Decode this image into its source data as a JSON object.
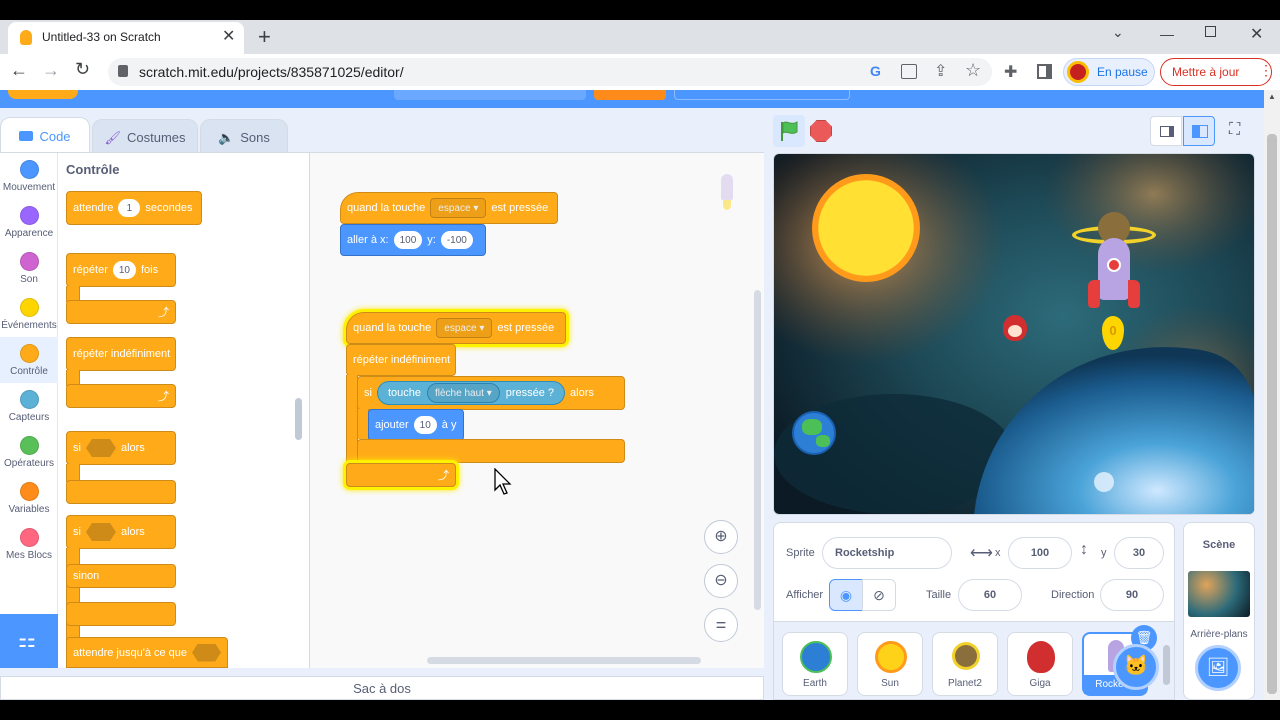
{
  "browser": {
    "tab_title": "Untitled-33 on Scratch",
    "url": "scratch.mit.edu/projects/835871025/editor/",
    "profile_status": "En pause",
    "update_button": "Mettre à jour"
  },
  "editor_tabs": {
    "code": "Code",
    "costumes": "Costumes",
    "sounds": "Sons"
  },
  "categories": [
    {
      "label": "Mouvement",
      "color": "#4c97ff"
    },
    {
      "label": "Apparence",
      "color": "#9966ff"
    },
    {
      "label": "Son",
      "color": "#cf63cf"
    },
    {
      "label": "Événements",
      "color": "#ffd500"
    },
    {
      "label": "Contrôle",
      "color": "#ffab19"
    },
    {
      "label": "Capteurs",
      "color": "#5cb1d6"
    },
    {
      "label": "Opérateurs",
      "color": "#59c059"
    },
    {
      "label": "Variables",
      "color": "#ff8c1a"
    },
    {
      "label": "Mes Blocs",
      "color": "#ff6680"
    }
  ],
  "palette": {
    "heading": "Contrôle",
    "wait": {
      "pre": "attendre",
      "value": "1",
      "post": "secondes"
    },
    "repeat": {
      "pre": "répéter",
      "value": "10",
      "post": "fois"
    },
    "forever": "répéter indéfiniment",
    "if_then": {
      "pre": "si",
      "post": "alors"
    },
    "if_else": {
      "pre": "si",
      "post": "alors",
      "else": "sinon"
    },
    "wait_until": "attendre jusqu'à ce que"
  },
  "script1": {
    "hat": {
      "pre": "quand la touche",
      "key": "espace",
      "post": "est pressée"
    },
    "goto": {
      "pre": "aller à x:",
      "x": "100",
      "ylabel": "y:",
      "y": "-100"
    }
  },
  "script2": {
    "hat": {
      "pre": "quand la touche",
      "key": "espace",
      "post": "est pressée"
    },
    "forever": "répéter indéfiniment",
    "if": {
      "pre": "si",
      "post": "alors"
    },
    "sensing": {
      "pre": "touche",
      "key": "flèche haut",
      "post": "pressée ?"
    },
    "change": {
      "pre": "ajouter",
      "value": "10",
      "post": "à y"
    }
  },
  "zoom": {
    "reset": "="
  },
  "backpack": "Sac à dos",
  "sprite_info": {
    "sprite_label": "Sprite",
    "sprite_name": "Rocketship",
    "x_label": "x",
    "x": "100",
    "y_label": "y",
    "y": "30",
    "show_label": "Afficher",
    "size_label": "Taille",
    "size": "60",
    "direction_label": "Direction",
    "direction": "90"
  },
  "sprites": [
    {
      "name": "Earth"
    },
    {
      "name": "Sun"
    },
    {
      "name": "Planet2"
    },
    {
      "name": "Giga"
    },
    {
      "name": "Rocket..."
    }
  ],
  "stage_panel": {
    "title": "Scène",
    "backdrops_label": "Arrière-plans"
  },
  "stage_sprite_label": "0"
}
